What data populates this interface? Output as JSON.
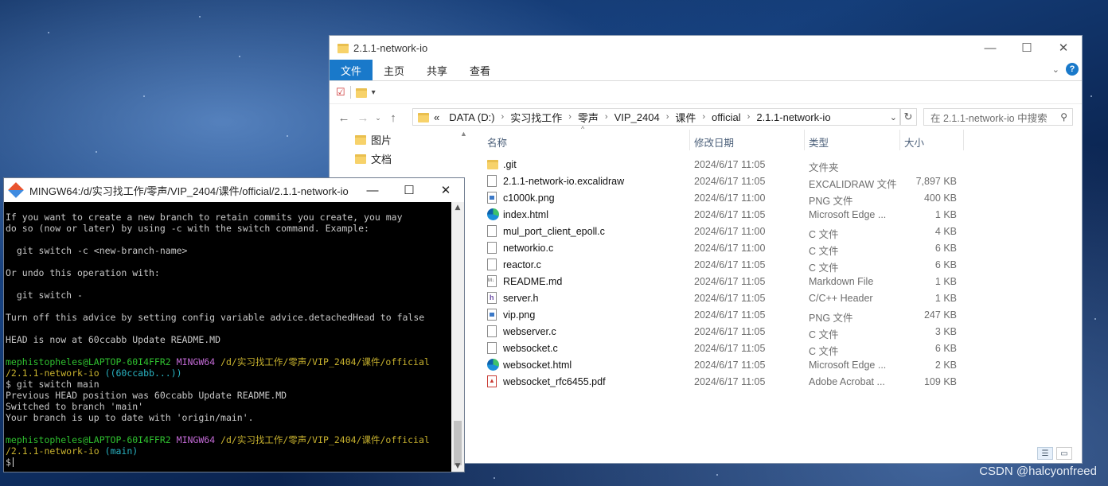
{
  "explorer": {
    "title": "2.1.1-network-io",
    "ribbon_tabs": [
      "文件",
      "主页",
      "共享",
      "查看"
    ],
    "breadcrumb_prefix": "«",
    "breadcrumbs": [
      "DATA (D:)",
      "实习找工作",
      "零声",
      "VIP_2404",
      "课件",
      "official",
      "2.1.1-network-io"
    ],
    "search_placeholder": "在 2.1.1-network-io 中搜索",
    "sidebar": [
      "图片",
      "文档"
    ],
    "columns": {
      "name": "名称",
      "date": "修改日期",
      "type": "类型",
      "size": "大小"
    },
    "files": [
      {
        "icon": "folder",
        "name": ".git",
        "date": "2024/6/17 11:05",
        "type": "文件夹",
        "size": ""
      },
      {
        "icon": "file",
        "name": "2.1.1-network-io.excalidraw",
        "date": "2024/6/17 11:05",
        "type": "EXCALIDRAW 文件",
        "size": "7,897 KB"
      },
      {
        "icon": "png",
        "name": "c1000k.png",
        "date": "2024/6/17 11:00",
        "type": "PNG 文件",
        "size": "400 KB"
      },
      {
        "icon": "edge",
        "name": "index.html",
        "date": "2024/6/17 11:05",
        "type": "Microsoft Edge ...",
        "size": "1 KB"
      },
      {
        "icon": "file",
        "name": "mul_port_client_epoll.c",
        "date": "2024/6/17 11:00",
        "type": "C 文件",
        "size": "4 KB"
      },
      {
        "icon": "file",
        "name": "networkio.c",
        "date": "2024/6/17 11:00",
        "type": "C 文件",
        "size": "6 KB"
      },
      {
        "icon": "file",
        "name": "reactor.c",
        "date": "2024/6/17 11:05",
        "type": "C 文件",
        "size": "6 KB"
      },
      {
        "icon": "md",
        "name": "README.md",
        "date": "2024/6/17 11:05",
        "type": "Markdown File",
        "size": "1 KB"
      },
      {
        "icon": "h",
        "name": "server.h",
        "date": "2024/6/17 11:05",
        "type": "C/C++ Header",
        "size": "1 KB"
      },
      {
        "icon": "png",
        "name": "vip.png",
        "date": "2024/6/17 11:05",
        "type": "PNG 文件",
        "size": "247 KB"
      },
      {
        "icon": "file",
        "name": "webserver.c",
        "date": "2024/6/17 11:05",
        "type": "C 文件",
        "size": "3 KB"
      },
      {
        "icon": "file",
        "name": "websocket.c",
        "date": "2024/6/17 11:05",
        "type": "C 文件",
        "size": "6 KB"
      },
      {
        "icon": "edge",
        "name": "websocket.html",
        "date": "2024/6/17 11:05",
        "type": "Microsoft Edge ...",
        "size": "2 KB"
      },
      {
        "icon": "pdf",
        "name": "websocket_rfc6455.pdf",
        "date": "2024/6/17 11:05",
        "type": "Adobe Acrobat ...",
        "size": "109 KB"
      }
    ]
  },
  "terminal": {
    "title": "MINGW64:/d/实习找工作/零声/VIP_2404/课件/official/2.1.1-network-io",
    "lines_top": [
      "If you want to create a new branch to retain commits you create, you may",
      "do so (now or later) by using -c with the switch command. Example:",
      "",
      "  git switch -c <new-branch-name>",
      "",
      "Or undo this operation with:",
      "",
      "  git switch -",
      "",
      "Turn off this advice by setting config variable advice.detachedHead to false",
      "",
      "HEAD is now at 60ccabb Update README.MD",
      ""
    ],
    "prompt1": {
      "user": "mephistopheles@LAPTOP-60I4FFR2",
      "env": "MINGW64",
      "path": "/d/实习找工作/零声/VIP_2404/课件/official",
      "path2": "/2.1.1-network-io",
      "branch": "((60ccabb...))"
    },
    "command1": "$ git switch main",
    "output1": [
      "Previous HEAD position was 60ccabb Update README.MD",
      "Switched to branch 'main'",
      "Your branch is up to date with 'origin/main'.",
      ""
    ],
    "prompt2": {
      "user": "mephistopheles@LAPTOP-60I4FFR2",
      "env": "MINGW64",
      "path": "/d/实习找工作/零声/VIP_2404/课件/official",
      "path2": "/2.1.1-network-io",
      "branch": "(main)"
    },
    "input_prompt": "$"
  },
  "watermark": "CSDN @halcyonfreed"
}
